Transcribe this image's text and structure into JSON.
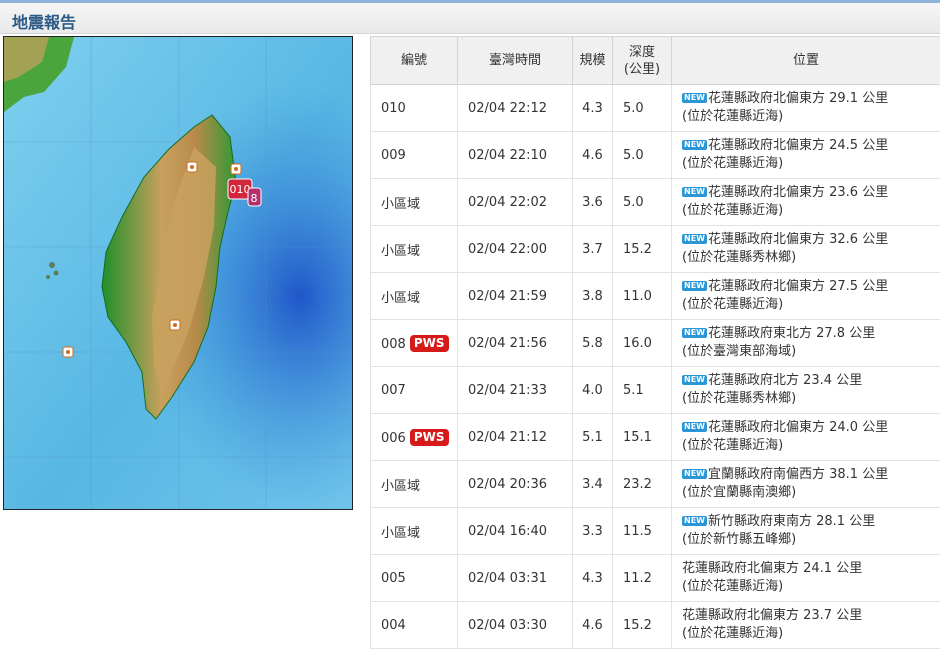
{
  "title": "地震報告",
  "map_markers": [
    "010",
    "8"
  ],
  "columns": [
    "編號",
    "臺灣時間",
    "規模",
    "深度",
    "(公里)",
    "位置"
  ],
  "new_badge": "NEW",
  "rows": [
    {
      "id": "010",
      "pws": "",
      "time": "02/04 22:12",
      "mag": "4.3",
      "depth": "5.0",
      "is_new": true,
      "loc1": "花蓮縣政府北偏東方 29.1 公里",
      "loc2": "(位於花蓮縣近海)"
    },
    {
      "id": "009",
      "pws": "",
      "time": "02/04 22:10",
      "mag": "4.6",
      "depth": "5.0",
      "is_new": true,
      "loc1": "花蓮縣政府北偏東方 24.5 公里",
      "loc2": "(位於花蓮縣近海)"
    },
    {
      "id": "小區域",
      "pws": "",
      "time": "02/04 22:02",
      "mag": "3.6",
      "depth": "5.0",
      "is_new": true,
      "loc1": "花蓮縣政府北偏東方 23.6 公里",
      "loc2": "(位於花蓮縣近海)"
    },
    {
      "id": "小區域",
      "pws": "",
      "time": "02/04 22:00",
      "mag": "3.7",
      "depth": "15.2",
      "is_new": true,
      "loc1": "花蓮縣政府北偏東方 32.6 公里",
      "loc2": "(位於花蓮縣秀林鄉)"
    },
    {
      "id": "小區域",
      "pws": "",
      "time": "02/04 21:59",
      "mag": "3.8",
      "depth": "11.0",
      "is_new": true,
      "loc1": "花蓮縣政府北偏東方 27.5 公里",
      "loc2": "(位於花蓮縣近海)"
    },
    {
      "id": "008",
      "pws": "PWS",
      "time": "02/04 21:56",
      "mag": "5.8",
      "depth": "16.0",
      "is_new": true,
      "loc1": "花蓮縣政府東北方 27.8 公里",
      "loc2": "(位於臺灣東部海域)"
    },
    {
      "id": "007",
      "pws": "",
      "time": "02/04 21:33",
      "mag": "4.0",
      "depth": "5.1",
      "is_new": true,
      "loc1": "花蓮縣政府北方 23.4 公里",
      "loc2": "(位於花蓮縣秀林鄉)"
    },
    {
      "id": "006",
      "pws": "PWS",
      "time": "02/04 21:12",
      "mag": "5.1",
      "depth": "15.1",
      "is_new": true,
      "loc1": "花蓮縣政府北偏東方 24.0 公里",
      "loc2": "(位於花蓮縣近海)"
    },
    {
      "id": "小區域",
      "pws": "",
      "time": "02/04 20:36",
      "mag": "3.4",
      "depth": "23.2",
      "is_new": true,
      "loc1": "宜蘭縣政府南偏西方 38.1 公里",
      "loc2": "(位於宜蘭縣南澳鄉)"
    },
    {
      "id": "小區域",
      "pws": "",
      "time": "02/04 16:40",
      "mag": "3.3",
      "depth": "11.5",
      "is_new": true,
      "loc1": "新竹縣政府東南方 28.1 公里",
      "loc2": "(位於新竹縣五峰鄉)"
    },
    {
      "id": "005",
      "pws": "",
      "time": "02/04 03:31",
      "mag": "4.3",
      "depth": "11.2",
      "is_new": false,
      "loc1": "花蓮縣政府北偏東方 24.1 公里",
      "loc2": "(位於花蓮縣近海)"
    },
    {
      "id": "004",
      "pws": "",
      "time": "02/04 03:30",
      "mag": "4.6",
      "depth": "15.2",
      "is_new": false,
      "loc1": "花蓮縣政府北偏東方 23.7 公里",
      "loc2": "(位於花蓮縣近海)"
    }
  ]
}
